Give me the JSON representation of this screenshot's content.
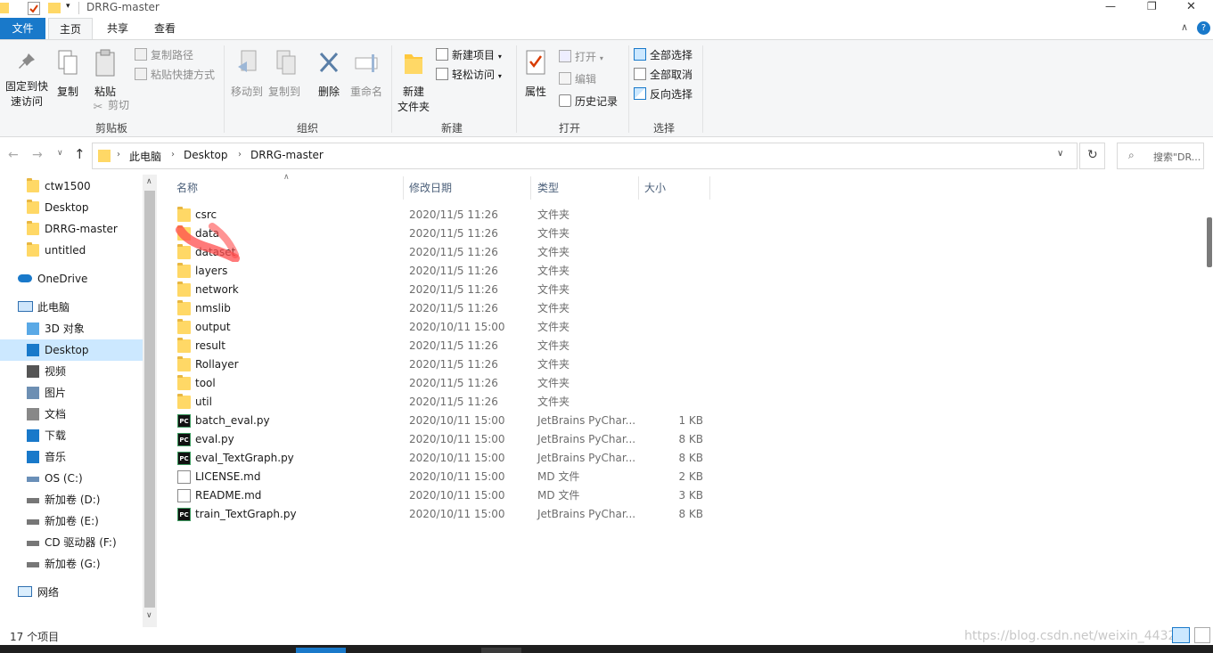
{
  "window": {
    "title": "DRRG-master",
    "controls": {
      "minimize": "—",
      "maximize": "❐",
      "close": "✕"
    }
  },
  "ribbon_tabs": [
    "文件",
    "主页",
    "共享",
    "查看"
  ],
  "ribbon": {
    "clipboard": {
      "pin_label": "固定到快\n速访问",
      "copy_label": "复制",
      "paste_label": "粘贴",
      "copy_path_label": "复制路径",
      "paste_shortcut_label": "粘贴快捷方式",
      "cut_label": "剪切",
      "group_label": "剪贴板"
    },
    "organize": {
      "move_to_label": "移动到",
      "copy_to_label": "复制到",
      "delete_label": "删除",
      "rename_label": "重命名",
      "group_label": "组织"
    },
    "new": {
      "new_folder_label": "新建\n文件夹",
      "new_item_label": "新建项目",
      "easy_access_label": "轻松访问",
      "group_label": "新建"
    },
    "open": {
      "properties_label": "属性",
      "open_label": "打开",
      "edit_label": "编辑",
      "history_label": "历史记录",
      "group_label": "打开"
    },
    "select": {
      "select_all_label": "全部选择",
      "select_none_label": "全部取消",
      "invert_label": "反向选择",
      "group_label": "选择"
    }
  },
  "address": {
    "breadcrumb": [
      "此电脑",
      "Desktop",
      "DRRG-master"
    ],
    "search_placeholder": "搜索\"DR..."
  },
  "nav": {
    "quick_access": [
      "ctw1500",
      "Desktop",
      "DRRG-master",
      "untitled"
    ],
    "onedrive": "OneDrive",
    "this_pc": "此电脑",
    "pc_items": [
      {
        "label": "3D 对象",
        "icon": "3d-objects-icon"
      },
      {
        "label": "Desktop",
        "icon": "desktop-icon"
      },
      {
        "label": "视频",
        "icon": "video-icon"
      },
      {
        "label": "图片",
        "icon": "pictures-icon"
      },
      {
        "label": "文档",
        "icon": "documents-icon"
      },
      {
        "label": "下载",
        "icon": "download-icon"
      },
      {
        "label": "音乐",
        "icon": "music-icon"
      },
      {
        "label": "OS (C:)",
        "icon": "os-drive-icon"
      },
      {
        "label": "新加卷 (D:)",
        "icon": "drive-icon"
      },
      {
        "label": "新加卷 (E:)",
        "icon": "drive-icon"
      },
      {
        "label": "CD 驱动器 (F:)",
        "icon": "cd-drive-icon"
      },
      {
        "label": "新加卷 (G:)",
        "icon": "drive-icon"
      }
    ],
    "network": "网络",
    "selected": "Desktop"
  },
  "columns": {
    "name": "名称",
    "date": "修改日期",
    "type": "类型",
    "size": "大小"
  },
  "files": [
    {
      "name": "csrc",
      "date": "2020/11/5 11:26",
      "type": "文件夹",
      "size": "",
      "kind": "folder"
    },
    {
      "name": "data",
      "date": "2020/11/5 11:26",
      "type": "文件夹",
      "size": "",
      "kind": "folder"
    },
    {
      "name": "dataset",
      "date": "2020/11/5 11:26",
      "type": "文件夹",
      "size": "",
      "kind": "folder"
    },
    {
      "name": "layers",
      "date": "2020/11/5 11:26",
      "type": "文件夹",
      "size": "",
      "kind": "folder"
    },
    {
      "name": "network",
      "date": "2020/11/5 11:26",
      "type": "文件夹",
      "size": "",
      "kind": "folder"
    },
    {
      "name": "nmslib",
      "date": "2020/11/5 11:26",
      "type": "文件夹",
      "size": "",
      "kind": "folder"
    },
    {
      "name": "output",
      "date": "2020/10/11 15:00",
      "type": "文件夹",
      "size": "",
      "kind": "folder"
    },
    {
      "name": "result",
      "date": "2020/11/5 11:26",
      "type": "文件夹",
      "size": "",
      "kind": "folder"
    },
    {
      "name": "Rollayer",
      "date": "2020/11/5 11:26",
      "type": "文件夹",
      "size": "",
      "kind": "folder"
    },
    {
      "name": "tool",
      "date": "2020/11/5 11:26",
      "type": "文件夹",
      "size": "",
      "kind": "folder"
    },
    {
      "name": "util",
      "date": "2020/11/5 11:26",
      "type": "文件夹",
      "size": "",
      "kind": "folder"
    },
    {
      "name": "batch_eval.py",
      "date": "2020/10/11 15:00",
      "type": "JetBrains PyChar...",
      "size": "1 KB",
      "kind": "py"
    },
    {
      "name": "eval.py",
      "date": "2020/10/11 15:00",
      "type": "JetBrains PyChar...",
      "size": "8 KB",
      "kind": "py"
    },
    {
      "name": "eval_TextGraph.py",
      "date": "2020/10/11 15:00",
      "type": "JetBrains PyChar...",
      "size": "8 KB",
      "kind": "py"
    },
    {
      "name": "LICENSE.md",
      "date": "2020/10/11 15:00",
      "type": "MD 文件",
      "size": "2 KB",
      "kind": "md"
    },
    {
      "name": "README.md",
      "date": "2020/10/11 15:00",
      "type": "MD 文件",
      "size": "3 KB",
      "kind": "md"
    },
    {
      "name": "train_TextGraph.py",
      "date": "2020/10/11 15:00",
      "type": "JetBrains PyChar...",
      "size": "8 KB",
      "kind": "py"
    }
  ],
  "status": {
    "item_count": "17 个项目"
  },
  "watermark": "https://blog.csdn.net/weixin_4432",
  "colors": {
    "accent": "#1979ca",
    "selected_bg": "#cce8ff",
    "annotation": "#ff4d4d"
  }
}
